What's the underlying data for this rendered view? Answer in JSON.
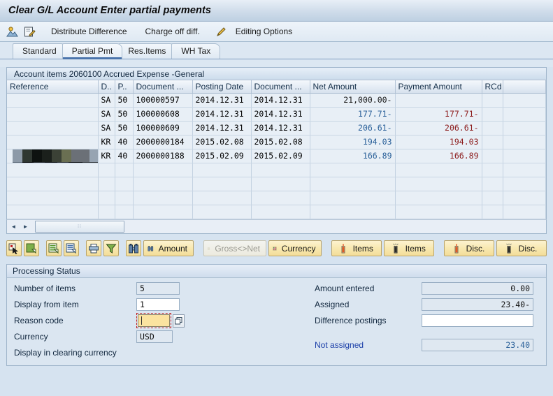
{
  "window": {
    "title": "Clear G/L Account Enter partial payments"
  },
  "app_toolbar": {
    "icons": [
      {
        "name": "person-mountain-icon",
        "glyph": "⛰"
      },
      {
        "name": "edit-document-icon",
        "glyph": "✎"
      }
    ],
    "items": [
      {
        "label": "Distribute Difference",
        "name": "distribute-difference"
      },
      {
        "label": "Charge off diff.",
        "name": "charge-off-diff"
      },
      {
        "label": "Editing Options",
        "name": "editing-options",
        "icon": "pencil-icon"
      }
    ]
  },
  "tabs": [
    {
      "label": "Standard",
      "selected": false
    },
    {
      "label": "Partial Pmt",
      "selected": true
    },
    {
      "label": "Res.Items",
      "selected": false
    },
    {
      "label": "WH Tax",
      "selected": false
    }
  ],
  "account_items": {
    "group_title": "Account items 2060100 Accrued Expense -General",
    "columns": [
      "Reference",
      "D..",
      "P..",
      "Document ...",
      "Posting Date",
      "Document ...",
      "Net Amount",
      "Payment Amount",
      "RCd"
    ],
    "rows": [
      {
        "reference": "",
        "doc_type": "SA",
        "posting_key": "50",
        "document_number": "100000597",
        "posting_date": "2014.12.31",
        "document_date": "2014.12.31",
        "net_amount": "21,000.00-",
        "payment_amount": "",
        "rcd": ""
      },
      {
        "reference": "",
        "doc_type": "SA",
        "posting_key": "50",
        "document_number": "100000608",
        "posting_date": "2014.12.31",
        "document_date": "2014.12.31",
        "net_amount": "177.71-",
        "payment_amount": "177.71-",
        "rcd": ""
      },
      {
        "reference": "",
        "doc_type": "SA",
        "posting_key": "50",
        "document_number": "100000609",
        "posting_date": "2014.12.31",
        "document_date": "2014.12.31",
        "net_amount": "206.61-",
        "payment_amount": "206.61-",
        "rcd": ""
      },
      {
        "reference": "",
        "doc_type": "KR",
        "posting_key": "40",
        "document_number": "2000000184",
        "posting_date": "2015.02.08",
        "document_date": "2015.02.08",
        "net_amount": "194.03",
        "payment_amount": "194.03",
        "rcd": ""
      },
      {
        "reference": "",
        "doc_type": "KR",
        "posting_key": "40",
        "document_number": "2000000188",
        "posting_date": "2015.02.09",
        "document_date": "2015.02.09",
        "net_amount": "166.89",
        "payment_amount": "166.89",
        "rcd": ""
      }
    ],
    "empty_row_count": 4
  },
  "grid_toolbar": [
    {
      "name": "select-cursor-button",
      "label": "",
      "icon": "cursor-select-icon",
      "disabled": false
    },
    {
      "name": "select-all-button",
      "label": "",
      "icon": "select-block-icon",
      "disabled": false
    },
    {
      "name": "activate-items-button",
      "label": "",
      "icon": "list-green-icon",
      "disabled": false
    },
    {
      "name": "deactivate-items-button",
      "label": "",
      "icon": "list-blue-icon",
      "disabled": false
    },
    {
      "name": "print-button",
      "label": "",
      "icon": "printer-icon",
      "disabled": false
    },
    {
      "name": "filter-button",
      "label": "",
      "icon": "funnel-icon",
      "disabled": false
    },
    {
      "name": "search-button",
      "label": "",
      "icon": "binoculars-icon",
      "disabled": false
    },
    {
      "name": "search-amount-button",
      "label": "Amount",
      "icon": "binoculars-icon",
      "disabled": false
    },
    {
      "name": "gross-net-button",
      "label": "Gross<>Net",
      "icon": "abacus-icon",
      "disabled": true
    },
    {
      "name": "currency-button",
      "label": "Currency",
      "icon": "abacus-red-icon",
      "disabled": false
    },
    {
      "name": "activate-items-label-button",
      "label": "Items",
      "icon": "candle-on-icon",
      "disabled": false
    },
    {
      "name": "deactivate-items-label-button",
      "label": "Items",
      "icon": "candle-off-icon",
      "disabled": false
    },
    {
      "name": "activate-disc-button",
      "label": "Disc.",
      "icon": "candle-on-icon",
      "disabled": false
    },
    {
      "name": "deactivate-disc-button",
      "label": "Disc.",
      "icon": "candle-off-icon",
      "disabled": false
    }
  ],
  "processing_status": {
    "title": "Processing Status",
    "left_fields": [
      {
        "label": "Number of items",
        "value": "5",
        "editable": false
      },
      {
        "label": "Display from item",
        "value": "1",
        "editable": true
      },
      {
        "label": "Reason code",
        "value": "",
        "editable": true,
        "focused": true
      },
      {
        "label": "Currency",
        "value": "USD",
        "editable": false
      }
    ],
    "clearing_currency_label": "Display in clearing currency",
    "right_fields": [
      {
        "label": "Amount entered",
        "value": "0.00",
        "editable": false
      },
      {
        "label": "Assigned",
        "value": "23.40-",
        "editable": false
      },
      {
        "label": "Difference postings",
        "value": "",
        "editable": true
      }
    ],
    "not_assigned": {
      "label": "Not assigned",
      "value": "23.40"
    }
  },
  "scrollbar": {
    "left_arrow": "◄",
    "right_arrow": "►",
    "grip": "∷"
  },
  "colors": {
    "accent": "#4a74ac",
    "net_amount": "#2a6099",
    "payment_amount": "#8b1a1a",
    "link": "#1a3ea8",
    "button_face": "#f8e8b0",
    "focus_field": "#fbe3a0",
    "focus_border": "#c02020"
  }
}
